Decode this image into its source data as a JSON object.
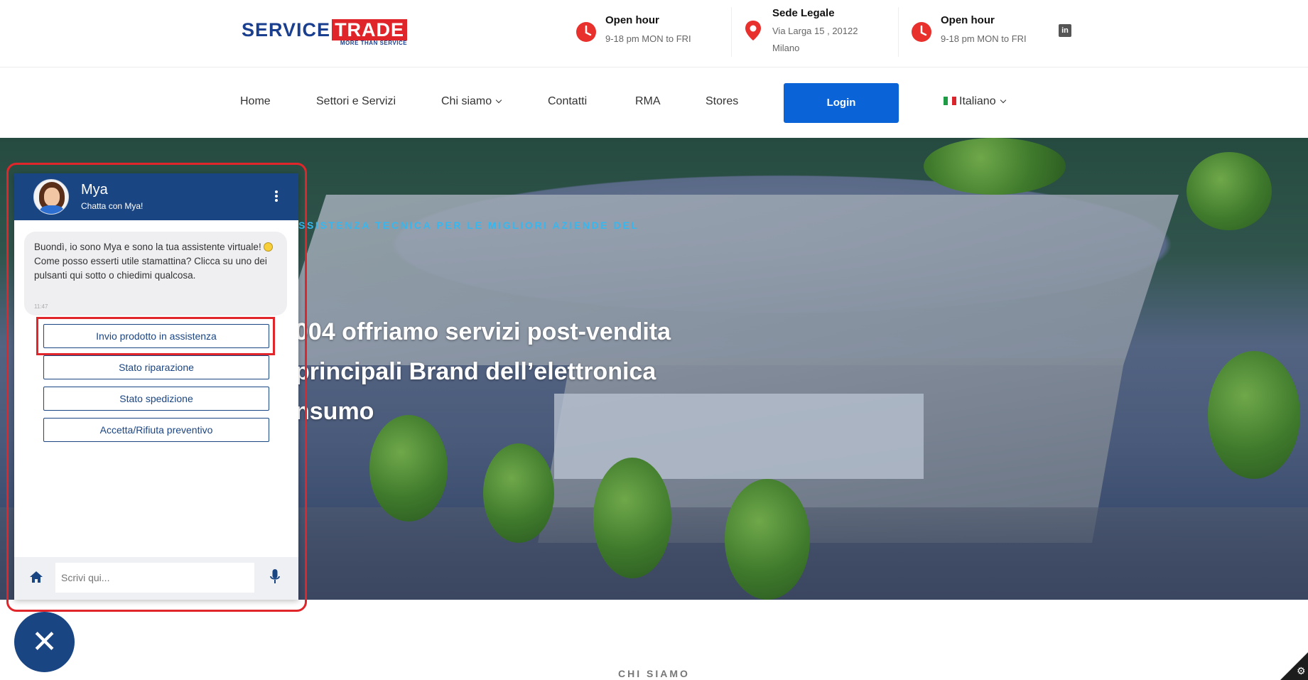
{
  "header": {
    "logo": {
      "part1": "SER",
      "part2": "VICE",
      "part3": "TRADE",
      "tagline": "MORE THAN SERVICE"
    },
    "info": [
      {
        "title": "Open hour",
        "line1": "9-18 pm MON to FRI",
        "line2": ""
      },
      {
        "title": "Sede Legale",
        "line1": "Via Larga 15 , 20122",
        "line2": "Milano"
      },
      {
        "title": "Open hour",
        "line1": "9-18 pm MON to FRI",
        "line2": ""
      }
    ],
    "linkedin_icon": "linkedin-icon"
  },
  "nav": {
    "items": [
      {
        "label": "Home"
      },
      {
        "label": "Settori e Servizi"
      },
      {
        "label": "Chi siamo"
      },
      {
        "label": "Contatti"
      },
      {
        "label": "RMA"
      },
      {
        "label": "Stores"
      }
    ],
    "login_label": "Login",
    "language": "Italiano"
  },
  "hero": {
    "subtitle": "SSISTENZA TECNICA PER LE MIGLIORI AZIENDE DEL",
    "title_line1": "004 offriamo servizi post-vendita",
    "title_line2": "principali Brand dell’elettronica",
    "title_line3": "nsumo"
  },
  "section": {
    "chi_siamo": "CHI SIAMO"
  },
  "chat": {
    "bot_name": "Mya",
    "bot_status": "Chatta con Mya!",
    "message_line1": "Buondì, io sono Mya e sono la tua assistente virtuale!",
    "message_line2": "Come posso esserti utile stamattina? Clicca su uno dei pulsanti qui sotto o chiedimi qualcosa.",
    "message_time": "11:47",
    "quick_replies": [
      {
        "label": "Invio prodotto in assistenza"
      },
      {
        "label": "Stato riparazione"
      },
      {
        "label": "Stato spedizione"
      },
      {
        "label": "Accetta/Rifiuta preventivo"
      }
    ],
    "input_placeholder": "Scrivi qui...",
    "close_symbol": "✕"
  },
  "colors": {
    "brand_blue": "#1a4583",
    "login_blue": "#0a64d8",
    "highlight_red": "#e0262a",
    "hero_subtitle_cyan": "#35b7f0",
    "icon_red": "#e8302c"
  }
}
